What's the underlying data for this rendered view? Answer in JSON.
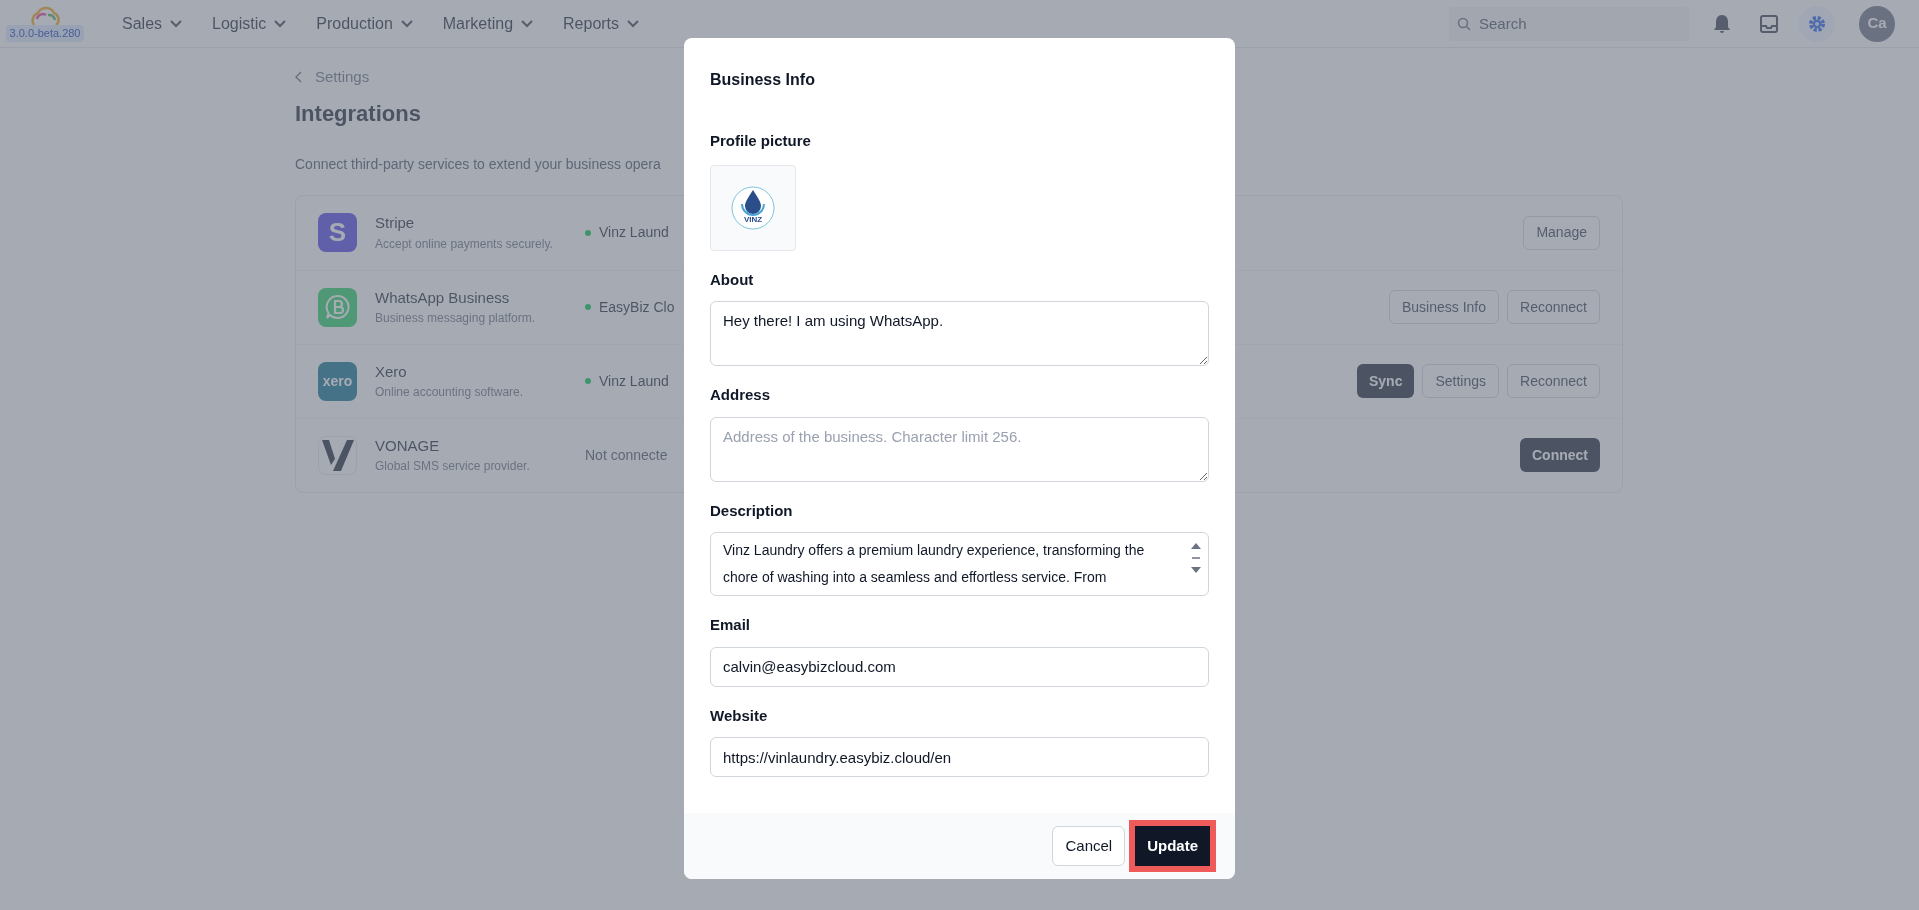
{
  "app": {
    "version": "3.0.0-beta.280"
  },
  "nav": [
    {
      "label": "Sales"
    },
    {
      "label": "Logistic"
    },
    {
      "label": "Production"
    },
    {
      "label": "Marketing"
    },
    {
      "label": "Reports"
    }
  ],
  "search": {
    "placeholder": "Search"
  },
  "avatar": {
    "initials": "Ca"
  },
  "breadcrumb": "Settings",
  "page_title": "Integrations",
  "page_description": "Connect third-party services to extend your business opera",
  "integrations": [
    {
      "kind": "stripe",
      "logo_text": "S",
      "name": "Stripe",
      "description": "Accept online payments securely.",
      "connected": true,
      "status": "Vinz Laund",
      "actions": [
        {
          "label": "Manage",
          "primary": false
        }
      ]
    },
    {
      "kind": "whatsapp",
      "name": "WhatsApp Business",
      "description": "Business messaging platform.",
      "connected": true,
      "status": "EasyBiz Clo",
      "actions": [
        {
          "label": "Business Info",
          "primary": false
        },
        {
          "label": "Reconnect",
          "primary": false
        }
      ]
    },
    {
      "kind": "xero",
      "logo_text": "xero",
      "name": "Xero",
      "description": "Online accounting software.",
      "connected": true,
      "status": "Vinz Laund",
      "actions": [
        {
          "label": "Sync",
          "primary": true
        },
        {
          "label": "Settings",
          "primary": false
        },
        {
          "label": "Reconnect",
          "primary": false
        }
      ]
    },
    {
      "kind": "vonage",
      "name": "VONAGE",
      "description": "Global SMS service provider.",
      "connected": false,
      "status": "Not connecte",
      "actions": [
        {
          "label": "Connect",
          "primary": true
        }
      ]
    }
  ],
  "modal": {
    "title": "Business Info",
    "profile_label": "Profile picture",
    "profile_logo_text": "VINZ",
    "fields": [
      {
        "kind": "textarea",
        "label": "About",
        "value": "Hey there! I am using WhatsApp."
      },
      {
        "kind": "textarea",
        "label": "Address",
        "placeholder": "Address of the business. Character limit 256."
      },
      {
        "kind": "scrolltext",
        "label": "Description",
        "value": "Vinz Laundry offers a premium laundry experience, transforming the chore of washing into a seamless and effortless service. From"
      },
      {
        "kind": "input",
        "label": "Email",
        "value": "calvin@easybizcloud.com"
      },
      {
        "kind": "input",
        "label": "Website",
        "value": "https://vinlaundry.easybiz.cloud/en"
      }
    ],
    "buttons": [
      {
        "label": "Cancel",
        "primary": false,
        "highlighted": false
      },
      {
        "label": "Update",
        "primary": true,
        "highlighted": true
      }
    ]
  }
}
